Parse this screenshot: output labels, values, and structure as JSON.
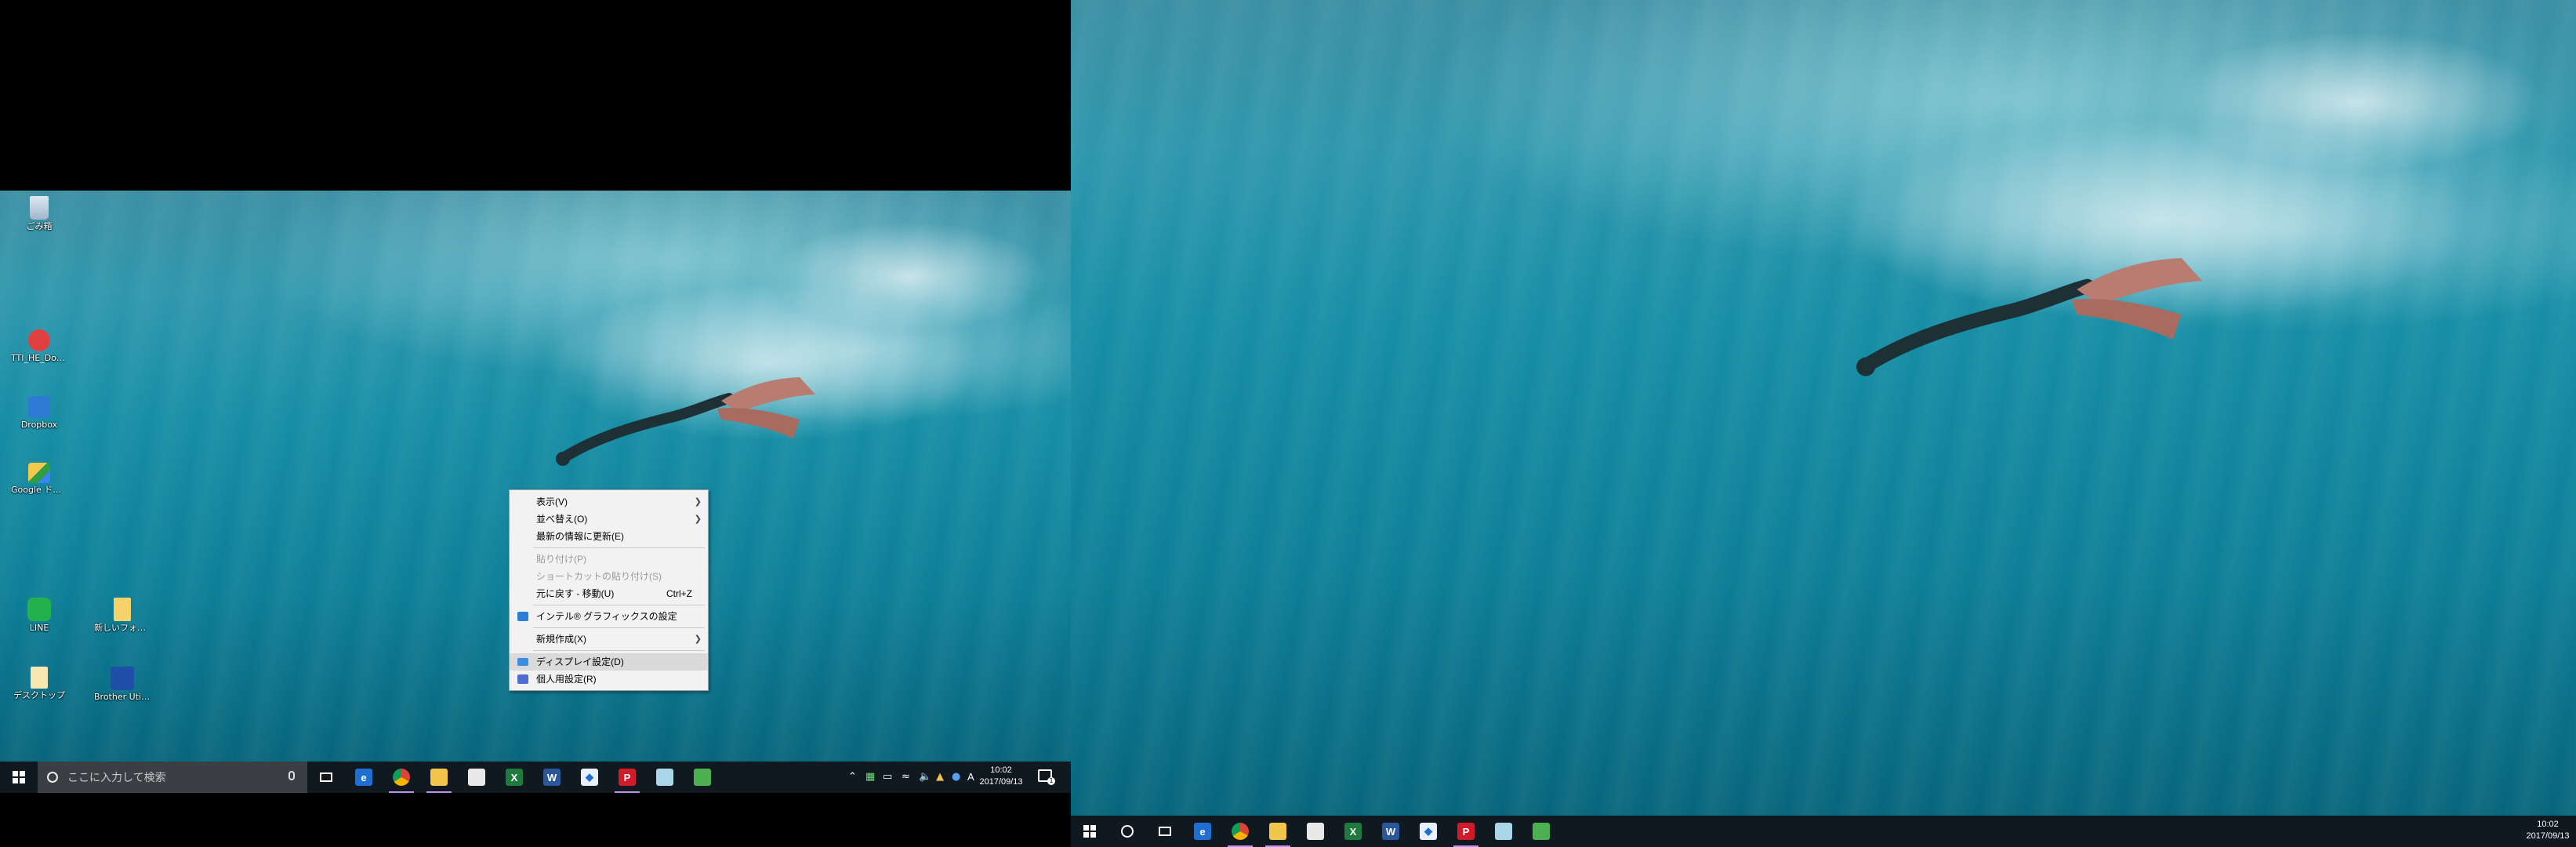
{
  "desktop_icons": [
    {
      "label": "ごみ箱"
    },
    {
      "label": "TTI_HE_Downloa..."
    },
    {
      "label": "Dropbox"
    },
    {
      "label": "Google ドライブ"
    },
    {
      "label": "LINE"
    },
    {
      "label": "新しいフォルダー"
    },
    {
      "label": "デスクトップ"
    },
    {
      "label": "Brother Utilities"
    }
  ],
  "context_menu": {
    "items": [
      {
        "label": "表示(V)"
      },
      {
        "label": "並べ替え(O)"
      },
      {
        "label": "最新の情報に更新(E)"
      },
      {
        "label": "貼り付け(P)"
      },
      {
        "label": "ショートカットの貼り付け(S)"
      },
      {
        "label": "元に戻す - 移動(U)",
        "shortcut": "Ctrl+Z"
      },
      {
        "label": "インテル® グラフィックスの設定"
      },
      {
        "label": "新規作成(X)"
      },
      {
        "label": "ディスプレイ設定(D)"
      },
      {
        "label": "個人用設定(R)"
      }
    ]
  },
  "taskbar_left": {
    "search_placeholder": "ここに入力して検索",
    "ime_indicator": "A",
    "time": "10:02",
    "date": "2017/09/13",
    "notification_count": "1"
  },
  "taskbar_right": {
    "time": "10:02",
    "date": "2017/09/13"
  },
  "taskbar_apps": [
    "edge-icon",
    "chrome-icon",
    "file-explorer-icon",
    "store-icon",
    "excel-icon",
    "word-icon",
    "dropbox-icon",
    "acrobat-icon",
    "notepad-icon",
    "evernote-icon"
  ],
  "colors": {
    "taskbar": "#101820",
    "active_indicator": "#c28ff0",
    "water": "#168ea5"
  }
}
